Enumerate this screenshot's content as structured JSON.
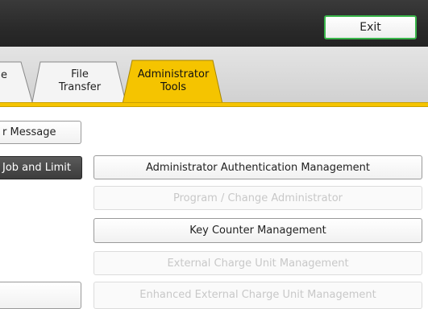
{
  "header": {
    "exit_label": "Exit"
  },
  "tabs": [
    {
      "label": "e"
    },
    {
      "line1": "File",
      "line2": "Transfer"
    },
    {
      "line1": "Administrator",
      "line2": "Tools",
      "selected": true
    }
  ],
  "left_menu": {
    "message_label": "r Message",
    "job_limit_label": "Job and Limit",
    "blank_label": ""
  },
  "settings": [
    {
      "label": "Administrator Authentication Management",
      "enabled": true
    },
    {
      "label": "Program / Change Administrator",
      "enabled": false
    },
    {
      "label": "Key Counter Management",
      "enabled": true
    },
    {
      "label": "External Charge Unit Management",
      "enabled": false
    },
    {
      "label": "Enhanced External Charge Unit Management",
      "enabled": false
    }
  ],
  "colors": {
    "accent_tab": "#f5c400",
    "exit_border": "#39b54a",
    "top_bar": "#2a2a2a"
  }
}
